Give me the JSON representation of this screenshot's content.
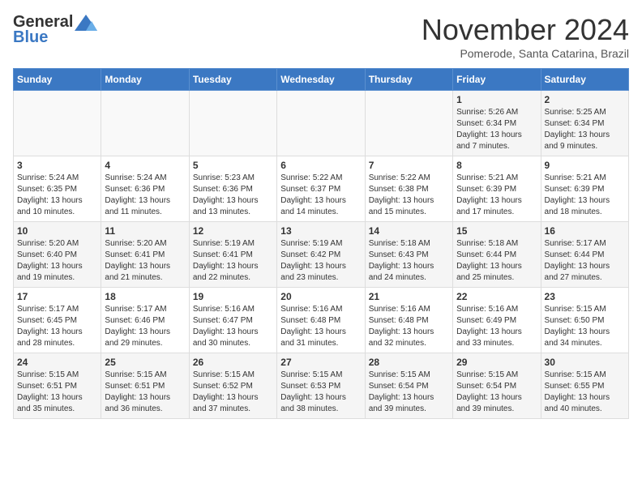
{
  "header": {
    "logo_line1": "General",
    "logo_line2": "Blue",
    "main_title": "November 2024",
    "subtitle": "Pomerode, Santa Catarina, Brazil"
  },
  "days_of_week": [
    "Sunday",
    "Monday",
    "Tuesday",
    "Wednesday",
    "Thursday",
    "Friday",
    "Saturday"
  ],
  "weeks": [
    [
      {
        "day": "",
        "info": ""
      },
      {
        "day": "",
        "info": ""
      },
      {
        "day": "",
        "info": ""
      },
      {
        "day": "",
        "info": ""
      },
      {
        "day": "",
        "info": ""
      },
      {
        "day": "1",
        "info": "Sunrise: 5:26 AM\nSunset: 6:34 PM\nDaylight: 13 hours and 7 minutes."
      },
      {
        "day": "2",
        "info": "Sunrise: 5:25 AM\nSunset: 6:34 PM\nDaylight: 13 hours and 9 minutes."
      }
    ],
    [
      {
        "day": "3",
        "info": "Sunrise: 5:24 AM\nSunset: 6:35 PM\nDaylight: 13 hours and 10 minutes."
      },
      {
        "day": "4",
        "info": "Sunrise: 5:24 AM\nSunset: 6:36 PM\nDaylight: 13 hours and 11 minutes."
      },
      {
        "day": "5",
        "info": "Sunrise: 5:23 AM\nSunset: 6:36 PM\nDaylight: 13 hours and 13 minutes."
      },
      {
        "day": "6",
        "info": "Sunrise: 5:22 AM\nSunset: 6:37 PM\nDaylight: 13 hours and 14 minutes."
      },
      {
        "day": "7",
        "info": "Sunrise: 5:22 AM\nSunset: 6:38 PM\nDaylight: 13 hours and 15 minutes."
      },
      {
        "day": "8",
        "info": "Sunrise: 5:21 AM\nSunset: 6:39 PM\nDaylight: 13 hours and 17 minutes."
      },
      {
        "day": "9",
        "info": "Sunrise: 5:21 AM\nSunset: 6:39 PM\nDaylight: 13 hours and 18 minutes."
      }
    ],
    [
      {
        "day": "10",
        "info": "Sunrise: 5:20 AM\nSunset: 6:40 PM\nDaylight: 13 hours and 19 minutes."
      },
      {
        "day": "11",
        "info": "Sunrise: 5:20 AM\nSunset: 6:41 PM\nDaylight: 13 hours and 21 minutes."
      },
      {
        "day": "12",
        "info": "Sunrise: 5:19 AM\nSunset: 6:41 PM\nDaylight: 13 hours and 22 minutes."
      },
      {
        "day": "13",
        "info": "Sunrise: 5:19 AM\nSunset: 6:42 PM\nDaylight: 13 hours and 23 minutes."
      },
      {
        "day": "14",
        "info": "Sunrise: 5:18 AM\nSunset: 6:43 PM\nDaylight: 13 hours and 24 minutes."
      },
      {
        "day": "15",
        "info": "Sunrise: 5:18 AM\nSunset: 6:44 PM\nDaylight: 13 hours and 25 minutes."
      },
      {
        "day": "16",
        "info": "Sunrise: 5:17 AM\nSunset: 6:44 PM\nDaylight: 13 hours and 27 minutes."
      }
    ],
    [
      {
        "day": "17",
        "info": "Sunrise: 5:17 AM\nSunset: 6:45 PM\nDaylight: 13 hours and 28 minutes."
      },
      {
        "day": "18",
        "info": "Sunrise: 5:17 AM\nSunset: 6:46 PM\nDaylight: 13 hours and 29 minutes."
      },
      {
        "day": "19",
        "info": "Sunrise: 5:16 AM\nSunset: 6:47 PM\nDaylight: 13 hours and 30 minutes."
      },
      {
        "day": "20",
        "info": "Sunrise: 5:16 AM\nSunset: 6:48 PM\nDaylight: 13 hours and 31 minutes."
      },
      {
        "day": "21",
        "info": "Sunrise: 5:16 AM\nSunset: 6:48 PM\nDaylight: 13 hours and 32 minutes."
      },
      {
        "day": "22",
        "info": "Sunrise: 5:16 AM\nSunset: 6:49 PM\nDaylight: 13 hours and 33 minutes."
      },
      {
        "day": "23",
        "info": "Sunrise: 5:15 AM\nSunset: 6:50 PM\nDaylight: 13 hours and 34 minutes."
      }
    ],
    [
      {
        "day": "24",
        "info": "Sunrise: 5:15 AM\nSunset: 6:51 PM\nDaylight: 13 hours and 35 minutes."
      },
      {
        "day": "25",
        "info": "Sunrise: 5:15 AM\nSunset: 6:51 PM\nDaylight: 13 hours and 36 minutes."
      },
      {
        "day": "26",
        "info": "Sunrise: 5:15 AM\nSunset: 6:52 PM\nDaylight: 13 hours and 37 minutes."
      },
      {
        "day": "27",
        "info": "Sunrise: 5:15 AM\nSunset: 6:53 PM\nDaylight: 13 hours and 38 minutes."
      },
      {
        "day": "28",
        "info": "Sunrise: 5:15 AM\nSunset: 6:54 PM\nDaylight: 13 hours and 39 minutes."
      },
      {
        "day": "29",
        "info": "Sunrise: 5:15 AM\nSunset: 6:54 PM\nDaylight: 13 hours and 39 minutes."
      },
      {
        "day": "30",
        "info": "Sunrise: 5:15 AM\nSunset: 6:55 PM\nDaylight: 13 hours and 40 minutes."
      }
    ]
  ]
}
